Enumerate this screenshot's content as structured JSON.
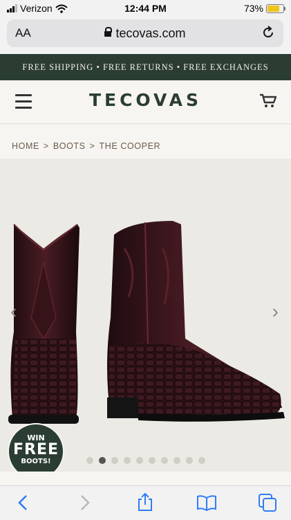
{
  "status_bar": {
    "carrier": "Verizon",
    "time": "12:44 PM",
    "battery": "73%",
    "battery_color": "#f0c419"
  },
  "browser": {
    "text_size_label": "AA",
    "url": "tecovas.com"
  },
  "promo": {
    "text": "FREE SHIPPING • FREE RETURNS • FREE EXCHANGES",
    "background": "#2b3d33"
  },
  "header": {
    "logo": "TECOVAS",
    "brand_color": "#2b3d33"
  },
  "breadcrumb": {
    "items": [
      "HOME",
      "BOOTS",
      "THE COOPER"
    ],
    "separator": ">"
  },
  "gallery": {
    "slide_count": 10,
    "active_index": 1
  },
  "badge": {
    "line1": "WIN",
    "line2": "FREE",
    "line3": "BOOTS!"
  },
  "toolbar": {
    "icons": [
      "back-icon",
      "forward-icon",
      "share-icon",
      "bookmarks-icon",
      "tabs-icon"
    ]
  }
}
